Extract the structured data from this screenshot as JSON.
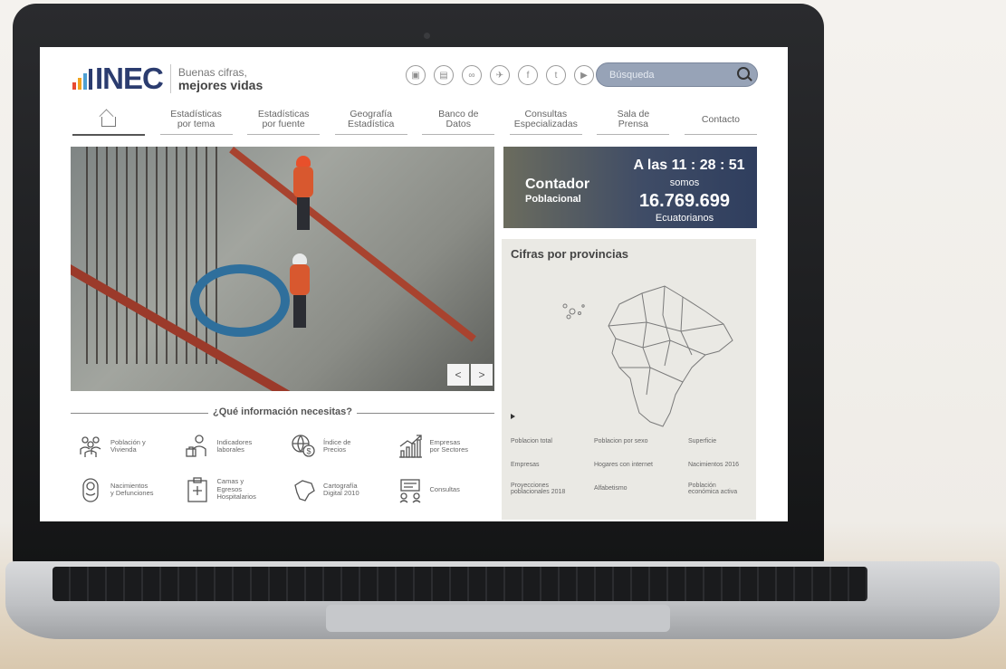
{
  "brand": {
    "logo": "INEC",
    "tagline_line1": "Buenas cifras,",
    "tagline_line2": "mejores vidas",
    "bar_colors": [
      "#e84a32",
      "#f0a41f",
      "#4d9fd2",
      "#2b3c6f"
    ]
  },
  "socials": [
    "icon-a",
    "icon-b",
    "icon-c",
    "icon-d",
    "facebook",
    "twitter",
    "youtube"
  ],
  "search": {
    "placeholder": "Búsqueda"
  },
  "nav": {
    "home_label": "home",
    "items": [
      "Estadísticas\npor tema",
      "Estadísticas\npor fuente",
      "Geografía\nEstadística",
      "Banco de\nDatos",
      "Consultas\nEspecializadas",
      "Sala de\nPrensa",
      "Contacto"
    ]
  },
  "slider": {
    "prev": "<",
    "next": ">"
  },
  "counter": {
    "title": "Contador",
    "subtitle": "Poblacional",
    "time": "A las  11 : 28 : 51",
    "somos": "somos",
    "number": "16.769.699",
    "unit": "Ecuatorianos"
  },
  "provinces": {
    "title": "Cifras por provincias",
    "links": [
      "Poblacion total",
      "Poblacion por sexo",
      "Superficie",
      "Empresas",
      "Hogares con internet",
      "Nacimientos 2016",
      "Proyecciones\npoblacionales 2018",
      "Alfabetismo",
      "Población\neconómica activa"
    ]
  },
  "info": {
    "title": "¿Qué información necesitas?",
    "categories": [
      {
        "label": "Población y\nVivienda",
        "icon": "people-icon"
      },
      {
        "label": "Indicadores\nlaborales",
        "icon": "worker-icon"
      },
      {
        "label": "Índice de\nPrecios",
        "icon": "prices-icon"
      },
      {
        "label": "Empresas\npor Sectores",
        "icon": "growth-chart-icon"
      },
      {
        "label": "Nacimientos\ny Defunciones",
        "icon": "baby-icon"
      },
      {
        "label": "Camas y\nEgresos\nHospitalarios",
        "icon": "hospital-icon"
      },
      {
        "label": "Cartografía\nDigital 2010",
        "icon": "map-icon"
      },
      {
        "label": "Consultas",
        "icon": "consult-icon"
      }
    ]
  }
}
